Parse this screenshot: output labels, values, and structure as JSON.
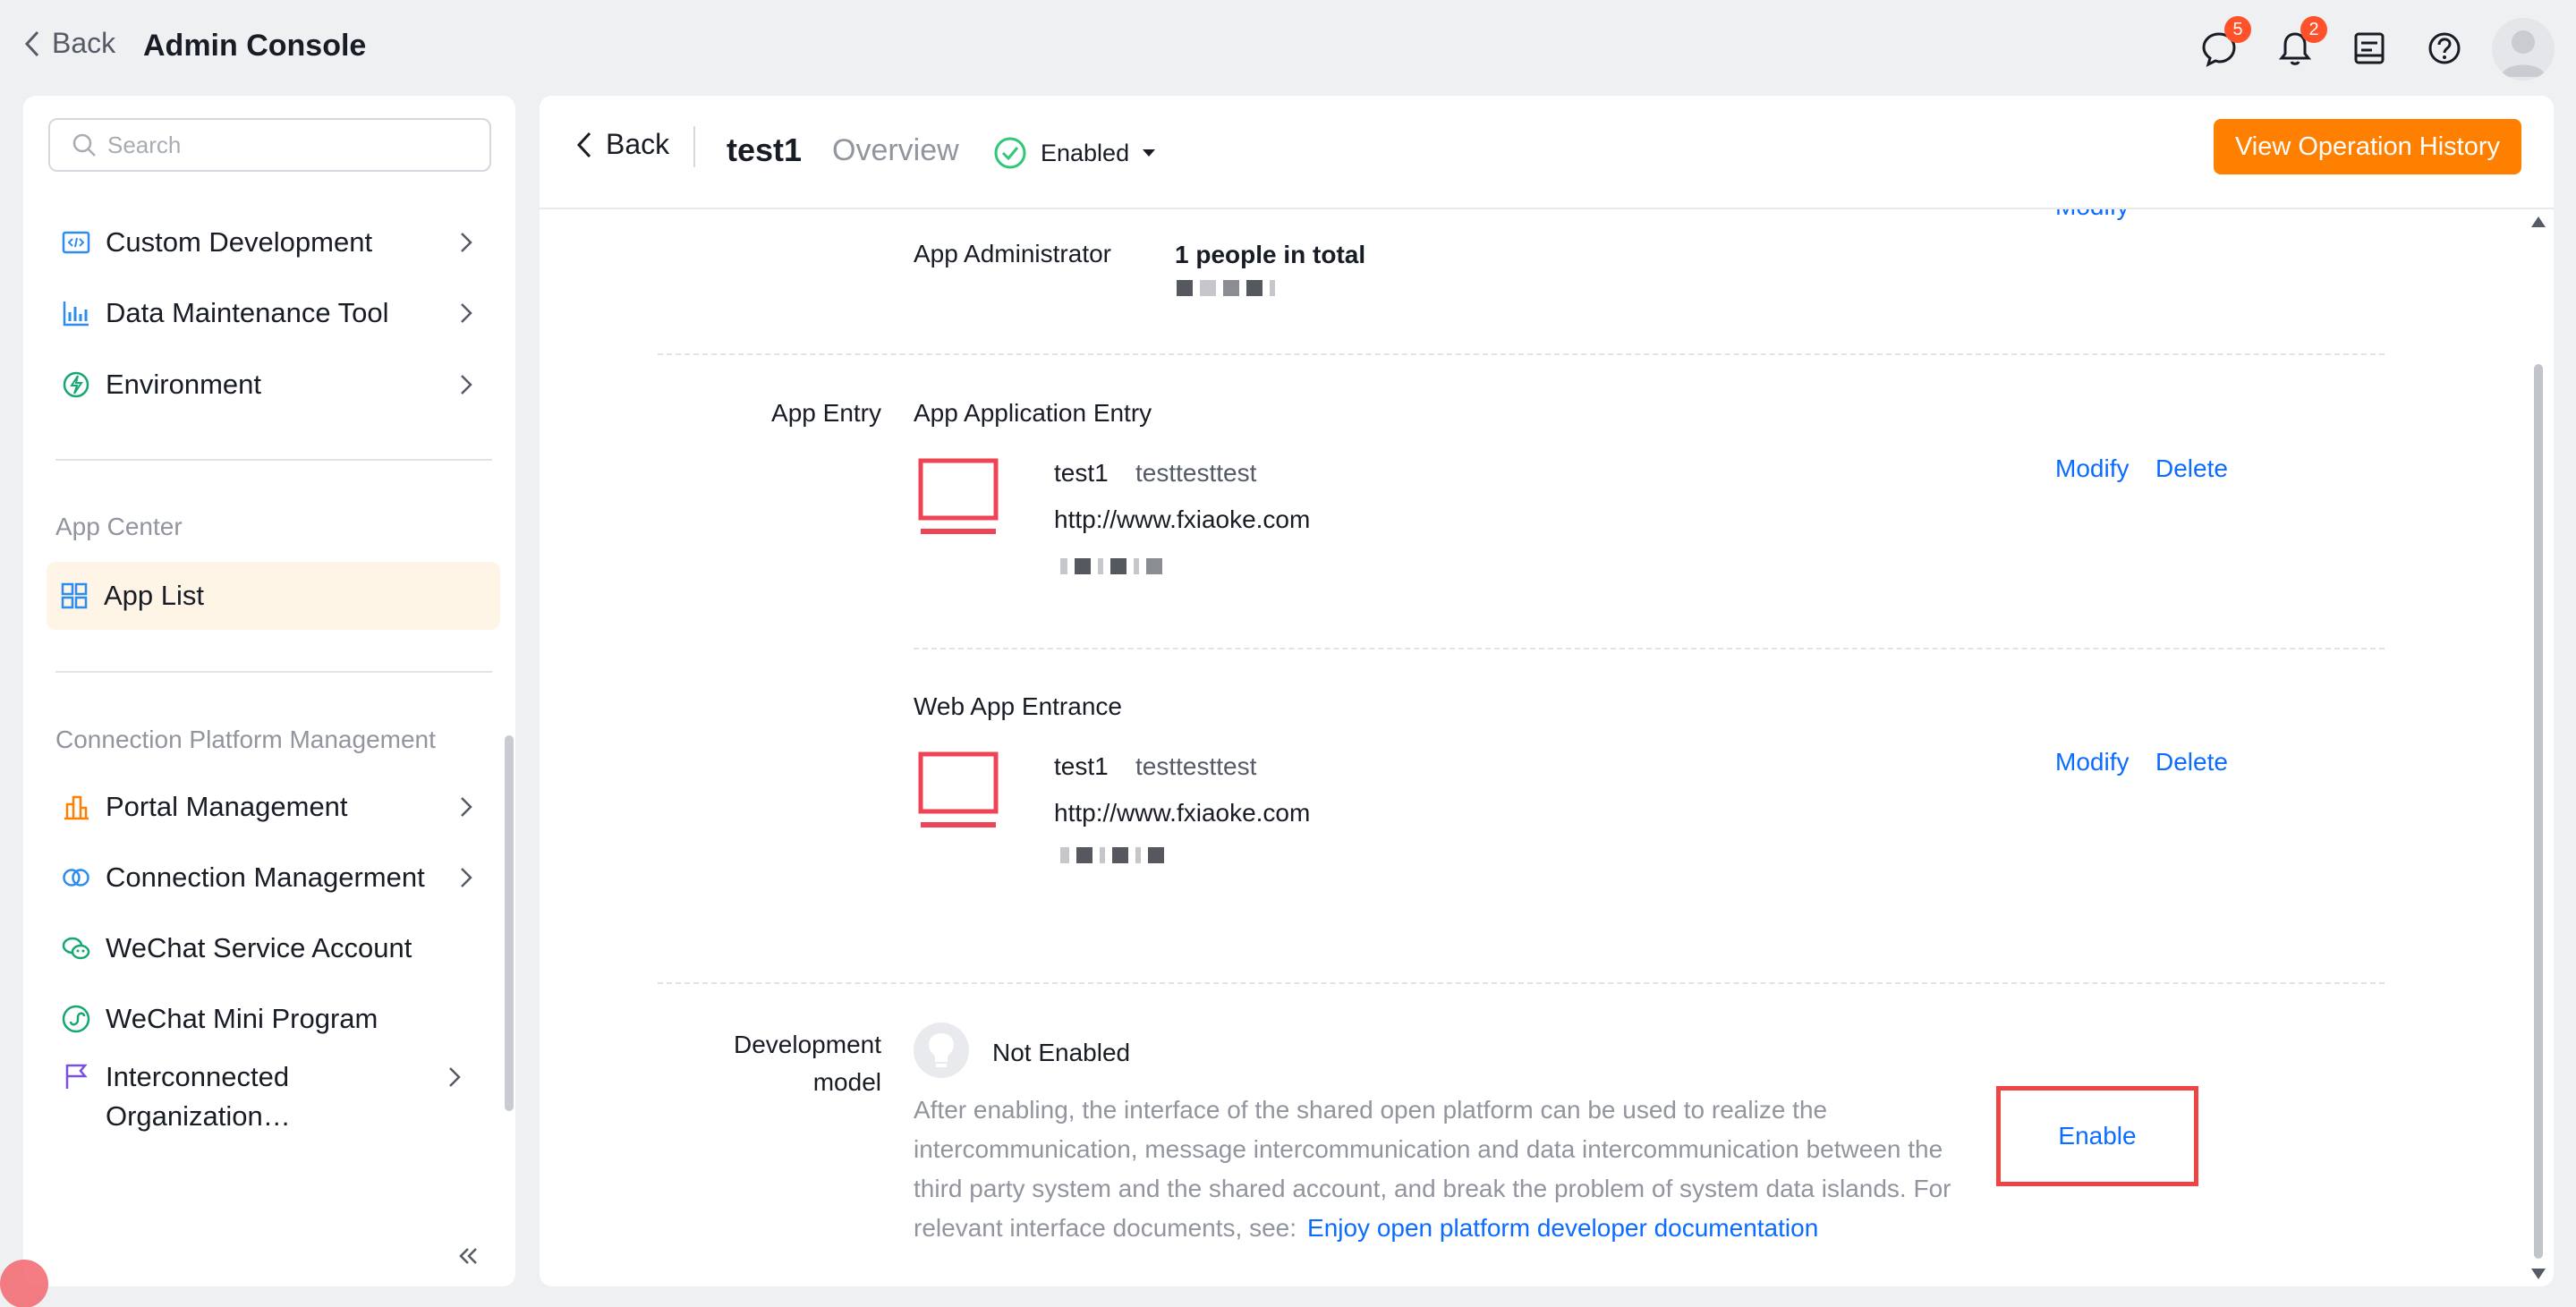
{
  "topbar": {
    "back_label": "Back",
    "title": "Admin Console",
    "messages_badge": "5",
    "notifications_badge": "2"
  },
  "sidebar": {
    "search_placeholder": "Search",
    "items_top": [
      {
        "label": "Custom Development",
        "icon": "code-icon"
      },
      {
        "label": "Data Maintenance Tool",
        "icon": "bar-chart-icon"
      },
      {
        "label": "Environment",
        "icon": "environment-icon"
      }
    ],
    "app_center_title": "App Center",
    "app_list_label": "App List",
    "connection_title": "Connection Platform Management",
    "items_conn": [
      {
        "label": "Portal Management",
        "icon": "portal-icon"
      },
      {
        "label": "Connection Managerment",
        "icon": "connection-icon"
      },
      {
        "label": "WeChat Service Account",
        "icon": "wechat-icon"
      },
      {
        "label": "WeChat Mini Program",
        "icon": "mini-program-icon"
      },
      {
        "label": "Interconnected Organization…",
        "icon": "flag-icon"
      }
    ]
  },
  "header": {
    "back_label": "Back",
    "app_name": "test1",
    "overview_label": "Overview",
    "status_label": "Enabled",
    "history_button": "View Operation History"
  },
  "admin": {
    "modify_label": "Modify",
    "label": "App Administrator",
    "count": "1 people in total"
  },
  "app_entry": {
    "label": "App Entry",
    "application_entry": {
      "title": "App Application Entry",
      "name": "test1",
      "desc": "testtesttest",
      "url": "http://www.fxiaoke.com",
      "modify": "Modify",
      "delete": "Delete"
    },
    "web_entry": {
      "title": "Web App Entrance",
      "name": "test1",
      "desc": "testtesttest",
      "url": "http://www.fxiaoke.com",
      "modify": "Modify",
      "delete": "Delete"
    }
  },
  "dev_model": {
    "label_line1": "Development",
    "label_line2": "model",
    "status": "Not Enabled",
    "description": "After enabling, the interface of the shared open platform can be used to realize the intercommunication, message intercommunication and data intercommunication between the third party system and the shared account, and break the problem of system data islands. For relevant interface documents, see:",
    "doc_link": "Enjoy open platform developer documentation",
    "enable_label": "Enable"
  },
  "colors": {
    "accent_orange": "#ff8000",
    "link_blue": "#0c6cff",
    "badge_red": "#ff522a",
    "active_bg": "#fff5e6",
    "app_icon_red": "#ee4455"
  }
}
